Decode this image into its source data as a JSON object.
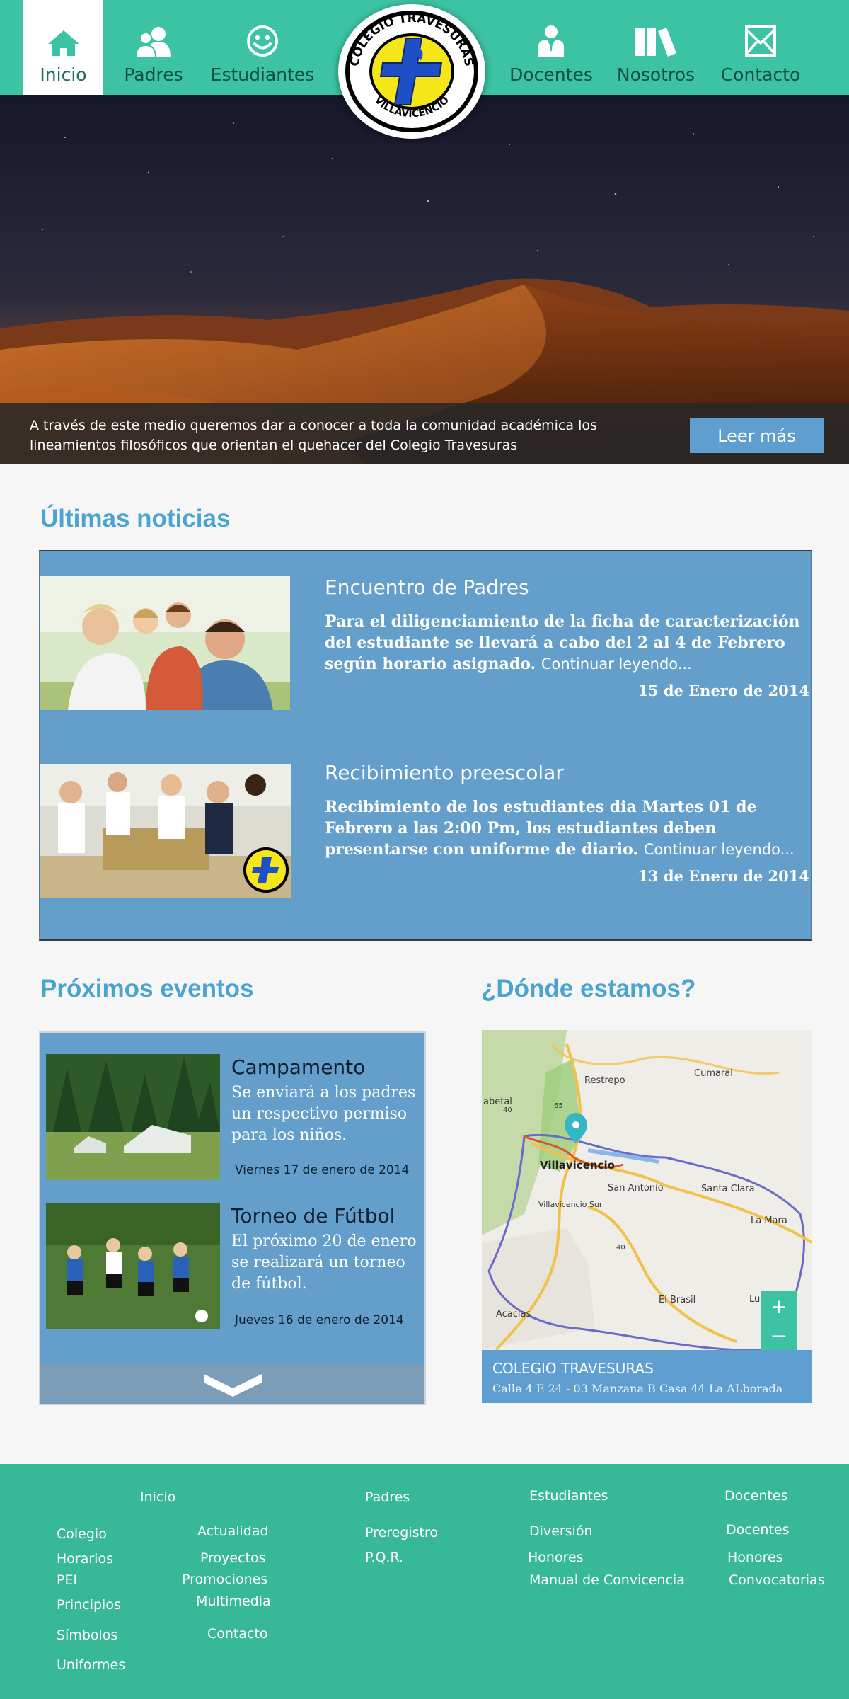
{
  "nav": {
    "items": [
      {
        "label": "Inicio",
        "icon": "home-icon"
      },
      {
        "label": "Padres",
        "icon": "parents-icon"
      },
      {
        "label": "Estudiantes",
        "icon": "smiley-icon"
      },
      {
        "label": "Docentes",
        "icon": "teacher-icon"
      },
      {
        "label": "Nosotros",
        "icon": "books-icon"
      },
      {
        "label": "Contacto",
        "icon": "mail-icon"
      }
    ],
    "active": "Inicio",
    "logo": {
      "top_text": "COLEGIO TRAVESURAS",
      "bottom_text": "VILLAVICENCIO"
    }
  },
  "hero": {
    "text": "A través de este medio queremos dar a conocer a toda la comunidad académica los lineamientos filosóficos que orientan el quehacer del Colegio Travesuras",
    "button": "Leer más"
  },
  "news": {
    "title": "Últimas noticias",
    "items": [
      {
        "title": "Encuentro de Padres",
        "desc": "Para el diligenciamiento de la ficha de caracterización del estudiante se llevará a cabo del 2 al 4 de Febrero según horario asignado.",
        "more": "Continuar leyendo...",
        "date": "15 de Enero de 2014"
      },
      {
        "title": "Recibimiento preescolar",
        "desc": "Recibimiento de los estudiantes dia Martes 01 de Febrero a las 2:00 Pm, los estudiantes deben presentarse con uniforme de diario.",
        "more": "Continuar leyendo...",
        "date": "13 de Enero de 2014"
      }
    ]
  },
  "events": {
    "title": "Próximos eventos",
    "items": [
      {
        "title": "Campamento",
        "desc": "Se enviará a los padres un respectivo permiso para los niños.",
        "date": "Viernes 17 de enero de 2014"
      },
      {
        "title": "Torneo de Fútbol",
        "desc": "El próximo 20 de enero se realizará un torneo de fútbol.",
        "date": "Jueves 16 de enero de 2014"
      }
    ]
  },
  "location": {
    "title": "¿Dónde estamos?",
    "map_labels": [
      "Restrepo",
      "Cumaral",
      "abetal",
      "Villavicencio",
      "San Antonio",
      "Santa Clara",
      "Villavicencio Sur",
      "La Mara",
      "El Brasil",
      "Acacias",
      "Lusitan",
      "65",
      "40",
      "40"
    ],
    "caption_title": "COLEGIO TRAVESURAS",
    "caption_address": "Calle 4 E 24 - 03 Manzana B Casa 44 La ALborada"
  },
  "footer": {
    "inicio": {
      "header": "Inicio",
      "left": [
        "Colegio",
        "Horarios",
        "PEI",
        "Principios",
        "Símbolos",
        "Uniformes"
      ],
      "right": [
        "Actualidad",
        "Proyectos",
        "Promociones",
        "Multimedia",
        "Contacto"
      ]
    },
    "padres": {
      "header": "Padres",
      "links": [
        "Preregistro",
        "P.Q.R."
      ]
    },
    "estudiantes": {
      "header": "Estudiantes",
      "links": [
        "Diversión",
        "Honores",
        "Manual de Convicencia"
      ]
    },
    "docentes": {
      "header": "Docentes",
      "links": [
        "Docentes",
        "Honores",
        "Convocatorias"
      ]
    }
  },
  "colors": {
    "nav": "#3cc3a4",
    "panel": "#639fca",
    "accent_title": "#4ba3d1",
    "footer": "#37b998",
    "button": "#5f9ed1"
  }
}
